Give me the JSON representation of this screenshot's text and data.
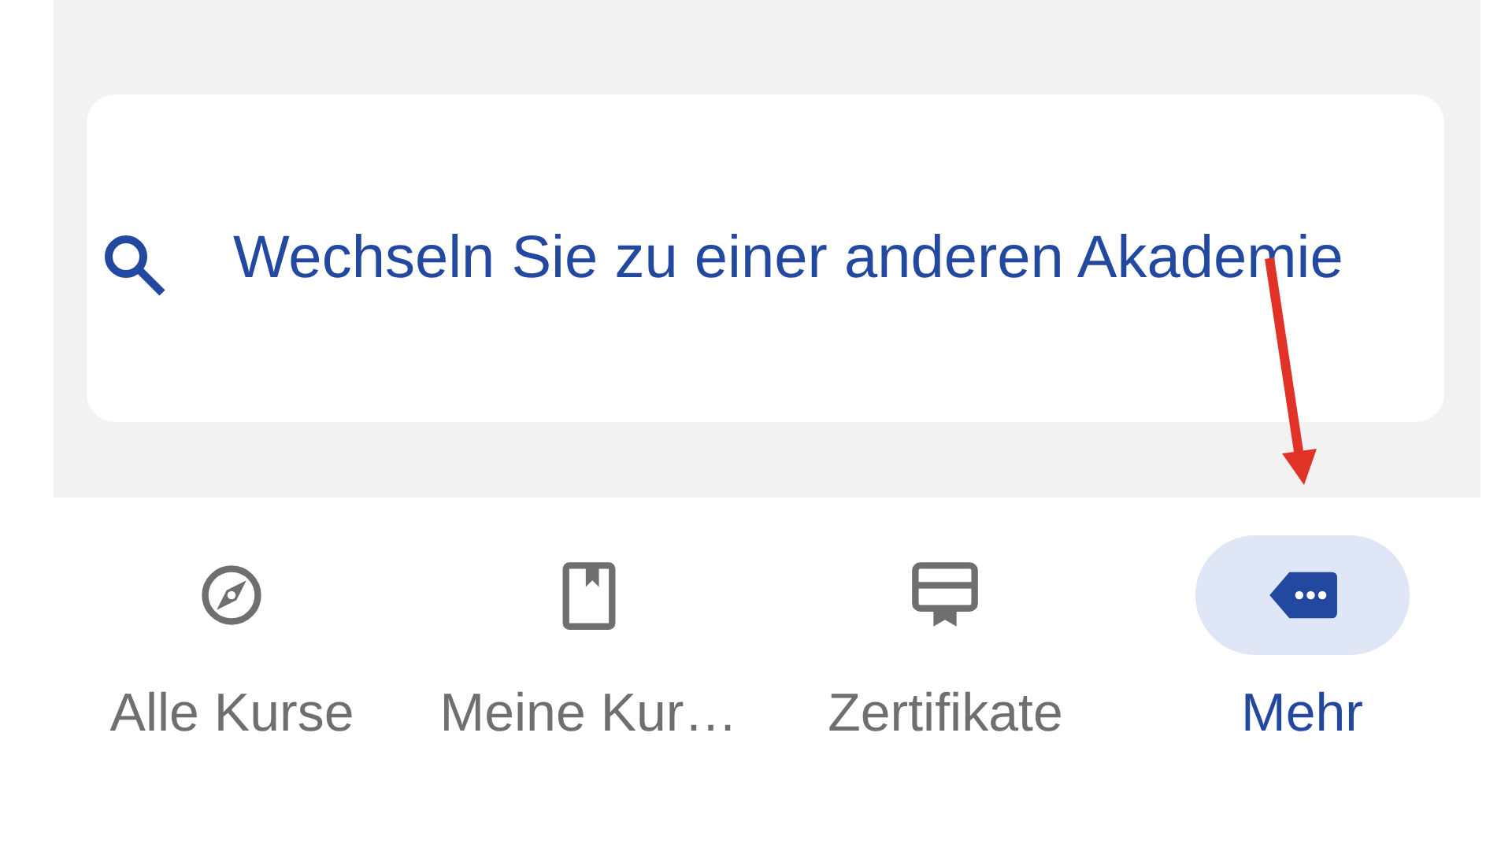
{
  "search": {
    "label": "Wechseln Sie zu einer anderen Akademie"
  },
  "bottom_nav": [
    {
      "label": "Alle Kurse",
      "selected": false
    },
    {
      "label": "Meine Kur…",
      "selected": false
    },
    {
      "label": "Zertifikate",
      "selected": false
    },
    {
      "label": "Mehr",
      "selected": true
    }
  ]
}
